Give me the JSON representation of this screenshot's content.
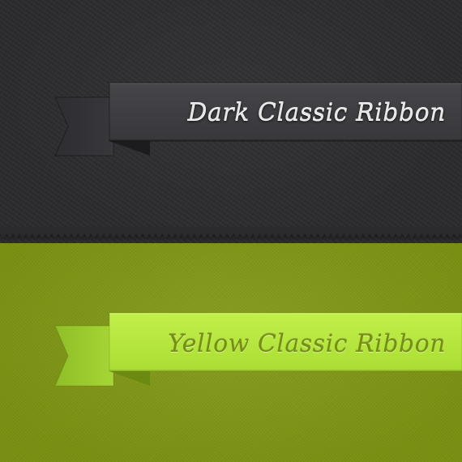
{
  "ribbons": [
    {
      "id": "dark",
      "label": "Dark Classic Ribbon",
      "colors": {
        "face": "#3b3a3e",
        "tail": "#333236",
        "fold": "#1c1b1e",
        "text": "#e6e6e6"
      }
    },
    {
      "id": "yellow",
      "label": "Yellow Classic Ribbon",
      "colors": {
        "face": "#b6e83c",
        "tail": "#9fcf2e",
        "fold": "#6b8a12",
        "text": "#768f12"
      }
    }
  ],
  "background": {
    "dark_panel": "#2b2a2d",
    "green_panel": "#7f9712"
  }
}
